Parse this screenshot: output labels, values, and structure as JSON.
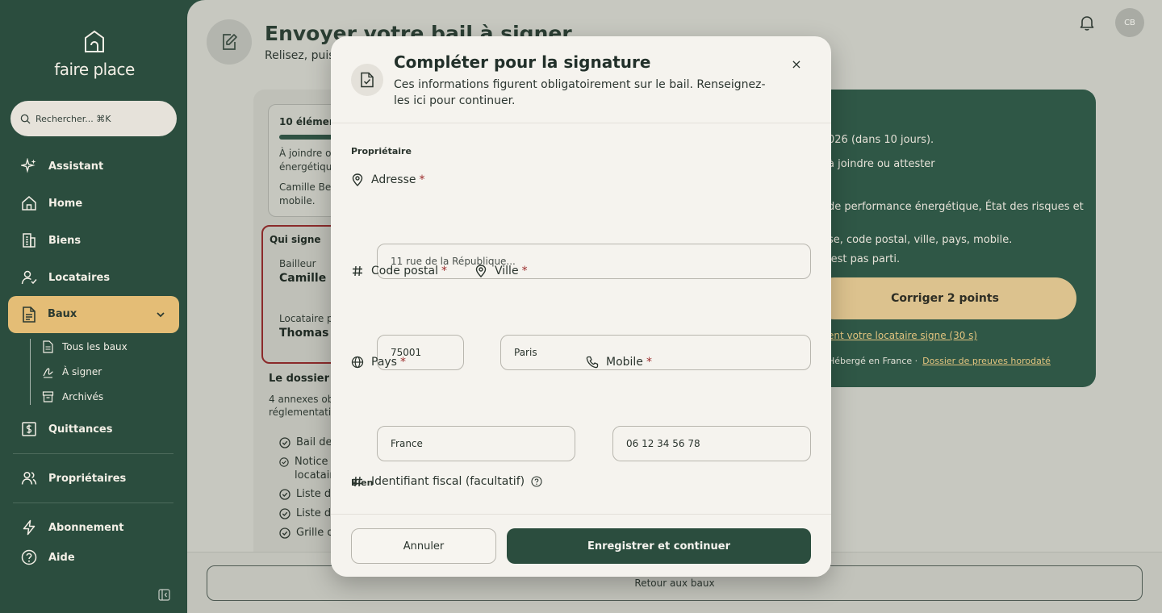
{
  "brand": {
    "name": "faire place"
  },
  "search": {
    "placeholder": "Rechercher... ⌘K"
  },
  "sidebar": {
    "items": [
      {
        "label": "Assistant"
      },
      {
        "label": "Home"
      },
      {
        "label": "Biens"
      },
      {
        "label": "Locataires"
      },
      {
        "label": "Baux"
      },
      {
        "label": "Quittances"
      },
      {
        "label": "Propriétaires"
      },
      {
        "label": "Abonnement"
      },
      {
        "label": "Aide"
      }
    ],
    "sub_items": [
      {
        "label": "Tous les baux"
      },
      {
        "label": "À signer"
      },
      {
        "label": "Archivés"
      }
    ]
  },
  "header": {
    "title": "Envoyer votre bail à signer",
    "subtitle": "Relisez, puis",
    "avatar": "CB"
  },
  "left_panel": {
    "box_title": "10 élémen",
    "box_p1a": "À joindre ou",
    "box_p1b": "énergétique",
    "box_p2a": "Camille Ber",
    "box_p2b": "mobile.",
    "qs_title": "Qui signe",
    "bailleur_label": "Bailleur",
    "bailleur_name": "Camille Be",
    "locataire_label": "Locataire pr",
    "locataire_name": "Thomas R",
    "dossier_title": "Le dossier e",
    "dossier_p1": "4 annexes obl",
    "dossier_p2": "réglementatio",
    "checks": [
      "Bail de",
      "Notice c",
      "locatair",
      "Liste de",
      "Liste de",
      "Grille d"
    ]
  },
  "right_panel": {
    "line1": "026 (dans 10 jours).",
    "line2": "à joindre ou attester",
    "line3": "de performance énergétique, État des risques et",
    "line4": "se, code postal, ville, pays, mobile.",
    "line5": "'est pas parti.",
    "button": "Corriger 2 points",
    "link": "ent votre locataire signe (30 s)",
    "footer": "Hébergé en France  ·",
    "footer_link": "Dossier de preuves horodaté"
  },
  "footer": {
    "back_label": "Retour aux baux"
  },
  "modal": {
    "title": "Compléter pour la signature",
    "description": "Ces informations figurent obligatoirement sur le bail. Renseignez-les ici pour continuer.",
    "close": "×",
    "section_owner": "Propriétaire",
    "section_property": "Bien",
    "required_mark": "*",
    "fields": {
      "address": {
        "label": "Adresse",
        "placeholder": "11 rue de la République..."
      },
      "postal_code": {
        "label": "Code postal",
        "value": "75001"
      },
      "city": {
        "label": "Ville",
        "value": "Paris"
      },
      "country": {
        "label": "Pays",
        "value": "France"
      },
      "mobile": {
        "label": "Mobile",
        "value": "06 12 34 56 78"
      },
      "tax_id": {
        "label": "Identifiant fiscal (facultatif)"
      }
    },
    "cancel_label": "Annuler",
    "save_label": "Enregistrer et continuer"
  }
}
